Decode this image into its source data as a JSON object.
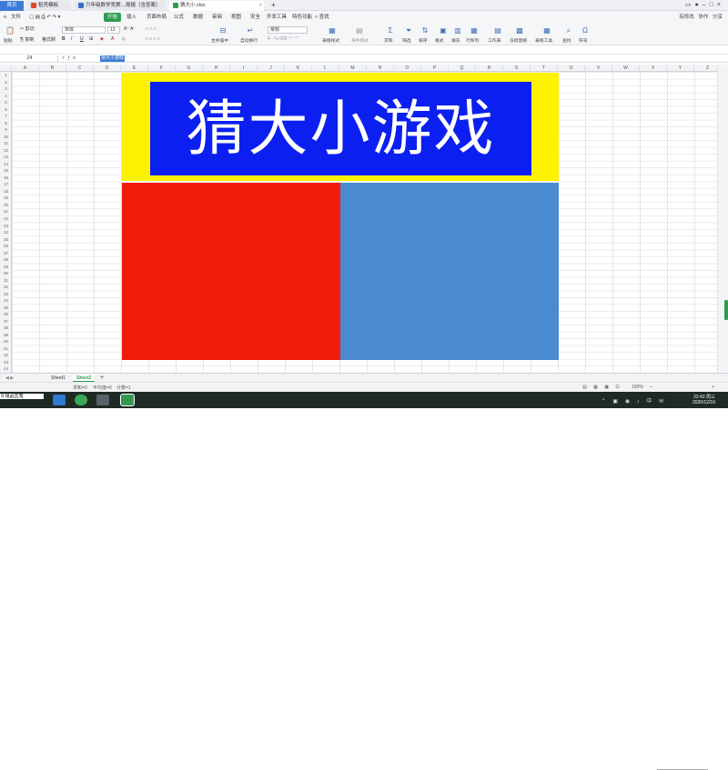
{
  "tabs": {
    "home": "首页",
    "tab1": "稻壳模板",
    "tab2": "六年级数学竞赛…周报（含答案）",
    "tab3": "猜大小.xlsx",
    "add": "+"
  },
  "menu": {
    "file": "文件",
    "start": "开始",
    "insert": "插入",
    "page_layout": "页面布局",
    "formula": "公式",
    "data": "数据",
    "review": "审阅",
    "view": "视图",
    "security": "安全",
    "dev_tools": "开发工具",
    "special": "特色功能",
    "search": "查找",
    "sync": "有修改",
    "collab": "协作",
    "share": "分享"
  },
  "toolbar": {
    "font_name": "宋体",
    "font_size": "12",
    "cell_style": "常规",
    "format_painter": "格式刷",
    "paste": "粘贴",
    "cut": "剪切",
    "copy": "复制",
    "merge": "合并居中",
    "wrap": "自动换行",
    "table_style": "表格样式",
    "cond_format": "条件格式",
    "sum": "求和",
    "filter": "筛选",
    "sort": "排序",
    "fill": "填充",
    "format": "格式",
    "row_col": "行和列",
    "worksheet": "工作表",
    "freeze": "冻结窗格",
    "table_tools": "表格工具",
    "find": "查找",
    "symbol": "符号"
  },
  "formula_bar": {
    "name_box": "Z4",
    "fx": "ƒx",
    "formula": "猜大小游戏"
  },
  "columns": [
    "A",
    "B",
    "C",
    "D",
    "E",
    "F",
    "G",
    "H",
    "I",
    "J",
    "K",
    "L",
    "M",
    "N",
    "O",
    "P",
    "Q",
    "R",
    "S",
    "T",
    "U",
    "V",
    "W",
    "X",
    "Y",
    "Z"
  ],
  "rows": [
    "1",
    "2",
    "3",
    "4",
    "5",
    "6",
    "7",
    "8",
    "9",
    "10",
    "11",
    "12",
    "13",
    "14",
    "15",
    "16",
    "17",
    "18",
    "19",
    "20",
    "21",
    "22",
    "23",
    "24",
    "25",
    "26",
    "27",
    "28",
    "29",
    "30",
    "31",
    "32",
    "33",
    "34",
    "35",
    "36",
    "37",
    "38",
    "39",
    "40",
    "41",
    "42",
    "43",
    "44"
  ],
  "game": {
    "title": "猜大小游戏",
    "colors": {
      "frame": "#fff200",
      "title_bg": "#0b20f0",
      "left_panel": "#f21c0a",
      "right_panel": "#4a8ad0"
    }
  },
  "sheets": {
    "sheet1": "Sheet1",
    "sheet2": "Sheet2",
    "add": "+"
  },
  "status": {
    "sum": "求和=0",
    "average": "平均值=0",
    "count": "计数=1",
    "zoom": "100%"
  },
  "taskbar": {
    "ime": "S 极品五笔",
    "time": "22:42 周三",
    "date": "2020/12/16"
  }
}
